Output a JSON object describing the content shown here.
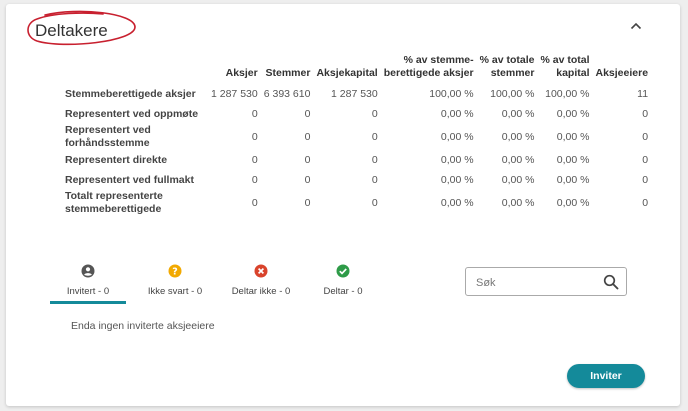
{
  "panel": {
    "title": "Deltakere"
  },
  "stats_table": {
    "headers": [
      "",
      "Aksjer",
      "Stemmer",
      "Aksjekapital",
      "% av stemme-\nberettigede aksjer",
      "% av totale\nstemmer",
      "% av total\nkapital",
      "Aksjeeiere"
    ],
    "rows": [
      [
        "Stemmeberettigede aksjer",
        "1 287 530",
        "6 393 610",
        "1 287 530",
        "100,00 %",
        "100,00 %",
        "100,00 %",
        "11"
      ],
      [
        "Representert ved oppmøte",
        "0",
        "0",
        "0",
        "0,00 %",
        "0,00 %",
        "0,00 %",
        "0"
      ],
      [
        "Representert ved forhåndsstemme",
        "0",
        "0",
        "0",
        "0,00 %",
        "0,00 %",
        "0,00 %",
        "0"
      ],
      [
        "Representert direkte",
        "0",
        "0",
        "0",
        "0,00 %",
        "0,00 %",
        "0,00 %",
        "0"
      ],
      [
        "Representert ved fullmakt",
        "0",
        "0",
        "0",
        "0,00 %",
        "0,00 %",
        "0,00 %",
        "0"
      ],
      [
        "Totalt representerte stemmeberettigede",
        "0",
        "0",
        "0",
        "0,00 %",
        "0,00 %",
        "0,00 %",
        "0"
      ]
    ]
  },
  "tabs": [
    {
      "label": "Invitert - 0",
      "icon": "person-icon",
      "color": "#555555",
      "active": true
    },
    {
      "label": "Ikke svart - 0",
      "icon": "question-icon",
      "color": "#f2a900",
      "active": false
    },
    {
      "label": "Deltar ikke - 0",
      "icon": "cancel-icon",
      "color": "#d9432c",
      "active": false
    },
    {
      "label": "Deltar - 0",
      "icon": "check-circle-icon",
      "color": "#2e9b48",
      "active": false
    }
  ],
  "search": {
    "placeholder": "Søk",
    "value": ""
  },
  "empty_message": "Enda ingen inviterte aksjeeiere",
  "invite_button": {
    "label": "Inviter"
  },
  "colors": {
    "accent": "#148a9a",
    "annotation": "#c8202f"
  }
}
